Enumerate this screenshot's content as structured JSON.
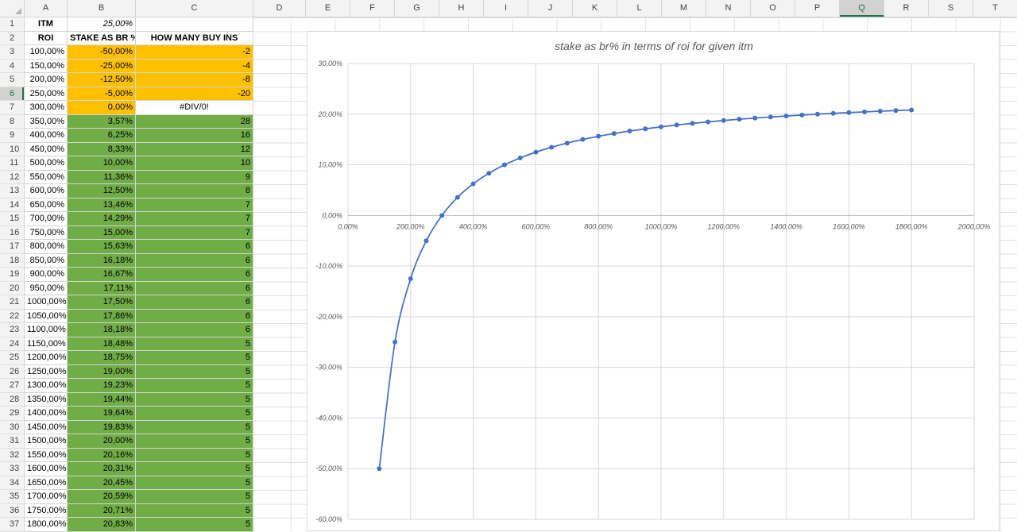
{
  "columns": [
    "A",
    "B",
    "C",
    "D",
    "E",
    "F",
    "G",
    "H",
    "I",
    "J",
    "K",
    "L",
    "M",
    "N",
    "O",
    "P",
    "Q",
    "R",
    "S",
    "T"
  ],
  "selected_column": "Q",
  "rows": [
    "1",
    "2",
    "3",
    "4",
    "5",
    "6",
    "7",
    "8",
    "9",
    "10",
    "11",
    "12",
    "13",
    "14",
    "15",
    "16",
    "17",
    "18",
    "19",
    "20",
    "21",
    "22",
    "23",
    "24",
    "25",
    "26",
    "27",
    "28",
    "29",
    "30",
    "31",
    "32",
    "33",
    "34",
    "35",
    "36",
    "37"
  ],
  "selected_row": "6",
  "sheet": {
    "itm_label": "ITM",
    "itm_value": "25,00%",
    "headers": {
      "roi": "ROI",
      "stake": "STAKE AS BR %",
      "buyins": "HOW MANY BUY INS"
    },
    "data": [
      {
        "roi": "100,00%",
        "stake": "-50,00%",
        "buyins": "-2",
        "color": "orange"
      },
      {
        "roi": "150,00%",
        "stake": "-25,00%",
        "buyins": "-4",
        "color": "orange"
      },
      {
        "roi": "200,00%",
        "stake": "-12,50%",
        "buyins": "-8",
        "color": "orange"
      },
      {
        "roi": "250,00%",
        "stake": "-5,00%",
        "buyins": "-20",
        "color": "orange"
      },
      {
        "roi": "300,00%",
        "stake": "0,00%",
        "buyins": "#DIV/0!",
        "color": "orange"
      },
      {
        "roi": "350,00%",
        "stake": "3,57%",
        "buyins": "28",
        "color": "green"
      },
      {
        "roi": "400,00%",
        "stake": "6,25%",
        "buyins": "16",
        "color": "green"
      },
      {
        "roi": "450,00%",
        "stake": "8,33%",
        "buyins": "12",
        "color": "green"
      },
      {
        "roi": "500,00%",
        "stake": "10,00%",
        "buyins": "10",
        "color": "green"
      },
      {
        "roi": "550,00%",
        "stake": "11,36%",
        "buyins": "9",
        "color": "green"
      },
      {
        "roi": "600,00%",
        "stake": "12,50%",
        "buyins": "8",
        "color": "green"
      },
      {
        "roi": "650,00%",
        "stake": "13,46%",
        "buyins": "7",
        "color": "green"
      },
      {
        "roi": "700,00%",
        "stake": "14,29%",
        "buyins": "7",
        "color": "green"
      },
      {
        "roi": "750,00%",
        "stake": "15,00%",
        "buyins": "7",
        "color": "green"
      },
      {
        "roi": "800,00%",
        "stake": "15,63%",
        "buyins": "6",
        "color": "green"
      },
      {
        "roi": "850,00%",
        "stake": "16,18%",
        "buyins": "6",
        "color": "green"
      },
      {
        "roi": "900,00%",
        "stake": "16,67%",
        "buyins": "6",
        "color": "green"
      },
      {
        "roi": "950,00%",
        "stake": "17,11%",
        "buyins": "6",
        "color": "green"
      },
      {
        "roi": "1000,00%",
        "stake": "17,50%",
        "buyins": "6",
        "color": "green"
      },
      {
        "roi": "1050,00%",
        "stake": "17,86%",
        "buyins": "6",
        "color": "green"
      },
      {
        "roi": "1100,00%",
        "stake": "18,18%",
        "buyins": "6",
        "color": "green"
      },
      {
        "roi": "1150,00%",
        "stake": "18,48%",
        "buyins": "5",
        "color": "green"
      },
      {
        "roi": "1200,00%",
        "stake": "18,75%",
        "buyins": "5",
        "color": "green"
      },
      {
        "roi": "1250,00%",
        "stake": "19,00%",
        "buyins": "5",
        "color": "green"
      },
      {
        "roi": "1300,00%",
        "stake": "19,23%",
        "buyins": "5",
        "color": "green"
      },
      {
        "roi": "1350,00%",
        "stake": "19,44%",
        "buyins": "5",
        "color": "green"
      },
      {
        "roi": "1400,00%",
        "stake": "19,64%",
        "buyins": "5",
        "color": "green"
      },
      {
        "roi": "1450,00%",
        "stake": "19,83%",
        "buyins": "5",
        "color": "green"
      },
      {
        "roi": "1500,00%",
        "stake": "20,00%",
        "buyins": "5",
        "color": "green"
      },
      {
        "roi": "1550,00%",
        "stake": "20,16%",
        "buyins": "5",
        "color": "green"
      },
      {
        "roi": "1600,00%",
        "stake": "20,31%",
        "buyins": "5",
        "color": "green"
      },
      {
        "roi": "1650,00%",
        "stake": "20,45%",
        "buyins": "5",
        "color": "green"
      },
      {
        "roi": "1700,00%",
        "stake": "20,59%",
        "buyins": "5",
        "color": "green"
      },
      {
        "roi": "1750,00%",
        "stake": "20,71%",
        "buyins": "5",
        "color": "green"
      },
      {
        "roi": "1800,00%",
        "stake": "20,83%",
        "buyins": "5",
        "color": "green"
      }
    ]
  },
  "colors": {
    "orange": "#ffc000",
    "green": "#70ad47",
    "series": "#4472c4",
    "selection": "#217346"
  },
  "chart_data": {
    "type": "scatter",
    "title": "stake as br% in terms of roi for given itm",
    "x": [
      100,
      150,
      200,
      250,
      300,
      350,
      400,
      450,
      500,
      550,
      600,
      650,
      700,
      750,
      800,
      850,
      900,
      950,
      1000,
      1050,
      1100,
      1150,
      1200,
      1250,
      1300,
      1350,
      1400,
      1450,
      1500,
      1550,
      1600,
      1650,
      1700,
      1750,
      1800
    ],
    "y": [
      -50,
      -25,
      -12.5,
      -5,
      0,
      3.57,
      6.25,
      8.33,
      10,
      11.36,
      12.5,
      13.46,
      14.29,
      15,
      15.63,
      16.18,
      16.67,
      17.11,
      17.5,
      17.86,
      18.18,
      18.48,
      18.75,
      19,
      19.23,
      19.44,
      19.64,
      19.83,
      20,
      20.16,
      20.31,
      20.45,
      20.59,
      20.71,
      20.83
    ],
    "xlim": [
      0,
      2000
    ],
    "ylim": [
      -60,
      30
    ],
    "xticks": [
      0,
      200,
      400,
      600,
      800,
      1000,
      1200,
      1400,
      1600,
      1800,
      2000
    ],
    "xtick_labels": [
      "0,00%",
      "200,00%",
      "400,00%",
      "600,00%",
      "800,00%",
      "1000,00%",
      "1200,00%",
      "1400,00%",
      "1600,00%",
      "1800,00%",
      "2000,00%"
    ],
    "yticks": [
      30,
      20,
      10,
      0,
      -10,
      -20,
      -30,
      -40,
      -50,
      -60
    ],
    "ytick_labels": [
      "30,00%",
      "20,00%",
      "10,00%",
      "0,00%",
      "-10,00%",
      "-20,00%",
      "-30,00%",
      "-40,00%",
      "-50,00%",
      "-60,00%"
    ],
    "grid": true,
    "markers": true,
    "line": "smooth"
  }
}
